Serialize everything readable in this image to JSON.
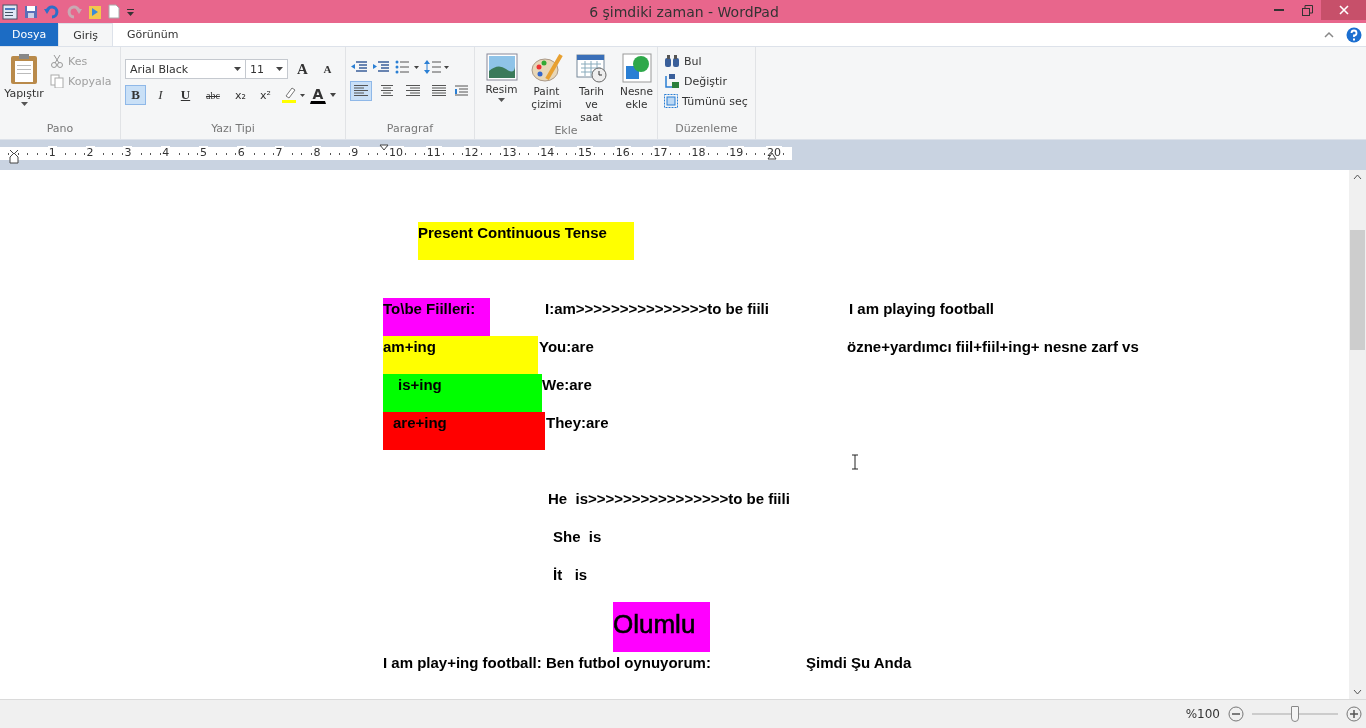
{
  "window": {
    "title": "6 şimdiki zaman - WordPad"
  },
  "tabs": [
    {
      "label": "Dosya",
      "kind": "file",
      "selected": false
    },
    {
      "label": "Giriş",
      "kind": "tab",
      "selected": true
    },
    {
      "label": "Görünüm",
      "kind": "tab",
      "selected": false
    }
  ],
  "ribbon": {
    "clipboard": {
      "label": "Pano",
      "paste": "Yapıştır",
      "cut": {
        "label": "Kes",
        "disabled": true
      },
      "copy": {
        "label": "Kopyala",
        "disabled": true
      }
    },
    "font": {
      "label": "Yazı Tipi",
      "family": "Arial Black",
      "size": "11",
      "grow": "A",
      "shrink": "A",
      "color_glyph": "A",
      "buttons": [
        {
          "kind": "bold",
          "glyph": "B",
          "selected": true
        },
        {
          "kind": "italic",
          "glyph": "I",
          "selected": false
        },
        {
          "kind": "underline",
          "glyph": "U",
          "selected": false
        },
        {
          "kind": "strike",
          "glyph": "abc",
          "selected": false
        },
        {
          "kind": "sub",
          "glyph": "x₂",
          "selected": false
        },
        {
          "kind": "sup",
          "glyph": "x²",
          "selected": false
        }
      ]
    },
    "paragraph": {
      "label": "Paragraf",
      "align": [
        {
          "kind": "left",
          "selected": true
        },
        {
          "kind": "center",
          "selected": false
        },
        {
          "kind": "right",
          "selected": false
        },
        {
          "kind": "justify",
          "selected": false
        }
      ]
    },
    "insert": {
      "label": "Ekle",
      "items": [
        {
          "kind": "picture",
          "label": "Resim"
        },
        {
          "kind": "paint",
          "label": "Paint çizimi"
        },
        {
          "kind": "datetime",
          "label": "Tarih ve saat"
        },
        {
          "kind": "object",
          "label": "Nesne ekle"
        }
      ]
    },
    "editing": {
      "label": "Düzenleme",
      "items": [
        {
          "kind": "find",
          "label": "Bul"
        },
        {
          "kind": "replace",
          "label": "Değiştir"
        },
        {
          "kind": "selectall",
          "label": "Tümünü seç"
        }
      ]
    }
  },
  "ruler": {
    "numbers": [
      "1",
      "2",
      "3",
      "4",
      "5",
      "6",
      "7",
      "8",
      "9",
      "10",
      "11",
      "12",
      "13",
      "14",
      "15",
      "16",
      "17",
      "18",
      "19",
      "20"
    ]
  },
  "document": {
    "lines": [
      {
        "segments": [
          {
            "text": "Present Continuous Tense",
            "color": "#ffff00"
          }
        ]
      },
      {
        "segments": [
          {
            "text": "To\\be Fiilleri:",
            "color": "#ff00ff"
          },
          {
            "text": "I:am>>>>>>>>>>>>>>>to be fiili"
          },
          {
            "text": "I am playing football"
          }
        ]
      },
      {
        "segments": [
          {
            "text": "am+ing",
            "color": "#ffff00"
          },
          {
            "text": "You:are"
          },
          {
            "text": "özne+yardımcı fiil+fiil+ing+ nesne zarf vs"
          }
        ]
      },
      {
        "segments": [
          {
            "text": "is+ing",
            "color": "#00ff00"
          },
          {
            "text": "We:are"
          }
        ]
      },
      {
        "segments": [
          {
            "text": "are+ing",
            "color": "#ff0000"
          },
          {
            "text": "They:are"
          }
        ]
      },
      {
        "segments": [
          {
            "text": "He  is>>>>>>>>>>>>>>>>to be fiili"
          }
        ]
      },
      {
        "segments": [
          {
            "text": "She  is"
          }
        ]
      },
      {
        "segments": [
          {
            "text": "İt   is"
          }
        ]
      },
      {
        "kind": "heading",
        "segments": [
          {
            "text": "Olumlu",
            "color": "#ff00ff"
          }
        ]
      },
      {
        "segments": [
          {
            "text": "I am play+ing football: Ben futbol oynuyorum:"
          },
          {
            "text": "Şimdi Şu Anda"
          }
        ]
      }
    ]
  },
  "status_bar": {
    "zoom": "%100",
    "level": 0.5
  }
}
